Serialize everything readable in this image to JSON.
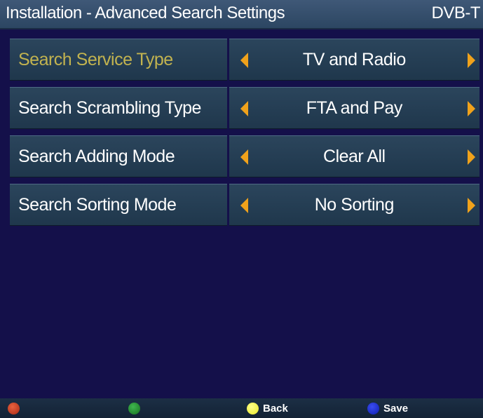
{
  "header": {
    "title": "Installation - Advanced Search Settings",
    "standard": "DVB-T"
  },
  "settings": [
    {
      "label": "Search Service Type",
      "value": "TV and Radio",
      "active": true
    },
    {
      "label": "Search Scrambling Type",
      "value": "FTA and Pay",
      "active": false
    },
    {
      "label": "Search Adding Mode",
      "value": "Clear All",
      "active": false
    },
    {
      "label": "Search Sorting Mode",
      "value": "No Sorting",
      "active": false
    }
  ],
  "footer": {
    "red_label": "",
    "green_label": "",
    "yellow_label": "Back",
    "blue_label": "Save"
  },
  "colors": {
    "background": "#14104a",
    "highlight_text": "#c2b34f",
    "arrow": "#f0a21b",
    "red_key": "#c0361e",
    "green_key": "#1f8a2c",
    "yellow_key": "#f2f23c",
    "blue_key": "#1226c8"
  }
}
